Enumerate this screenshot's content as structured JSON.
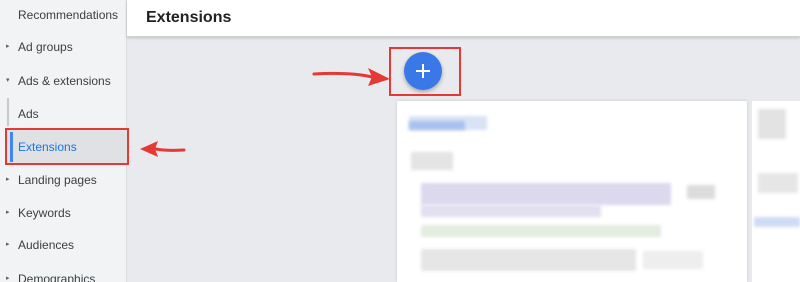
{
  "sidebar": {
    "items": [
      {
        "label": "Recommendations",
        "has_caret": false
      },
      {
        "label": "Ad groups",
        "has_caret": true
      },
      {
        "label": "Ads & extensions",
        "has_caret": true,
        "expanded": true
      },
      {
        "label": "Ads",
        "has_caret": false,
        "sub": true
      },
      {
        "label": "Extensions",
        "has_caret": false,
        "sub": true,
        "active": true
      },
      {
        "label": "Landing pages",
        "has_caret": true
      },
      {
        "label": "Keywords",
        "has_caret": true
      },
      {
        "label": "Audiences",
        "has_caret": true
      },
      {
        "label": "Demographics",
        "has_caret": true
      }
    ],
    "caret_collapsed": "▸",
    "caret_expanded": "▾"
  },
  "header": {
    "title": "Extensions"
  },
  "fab": {
    "icon": "plus-icon",
    "color": "#3b78e7"
  },
  "annotations": {
    "highlight_color": "#e53935"
  }
}
